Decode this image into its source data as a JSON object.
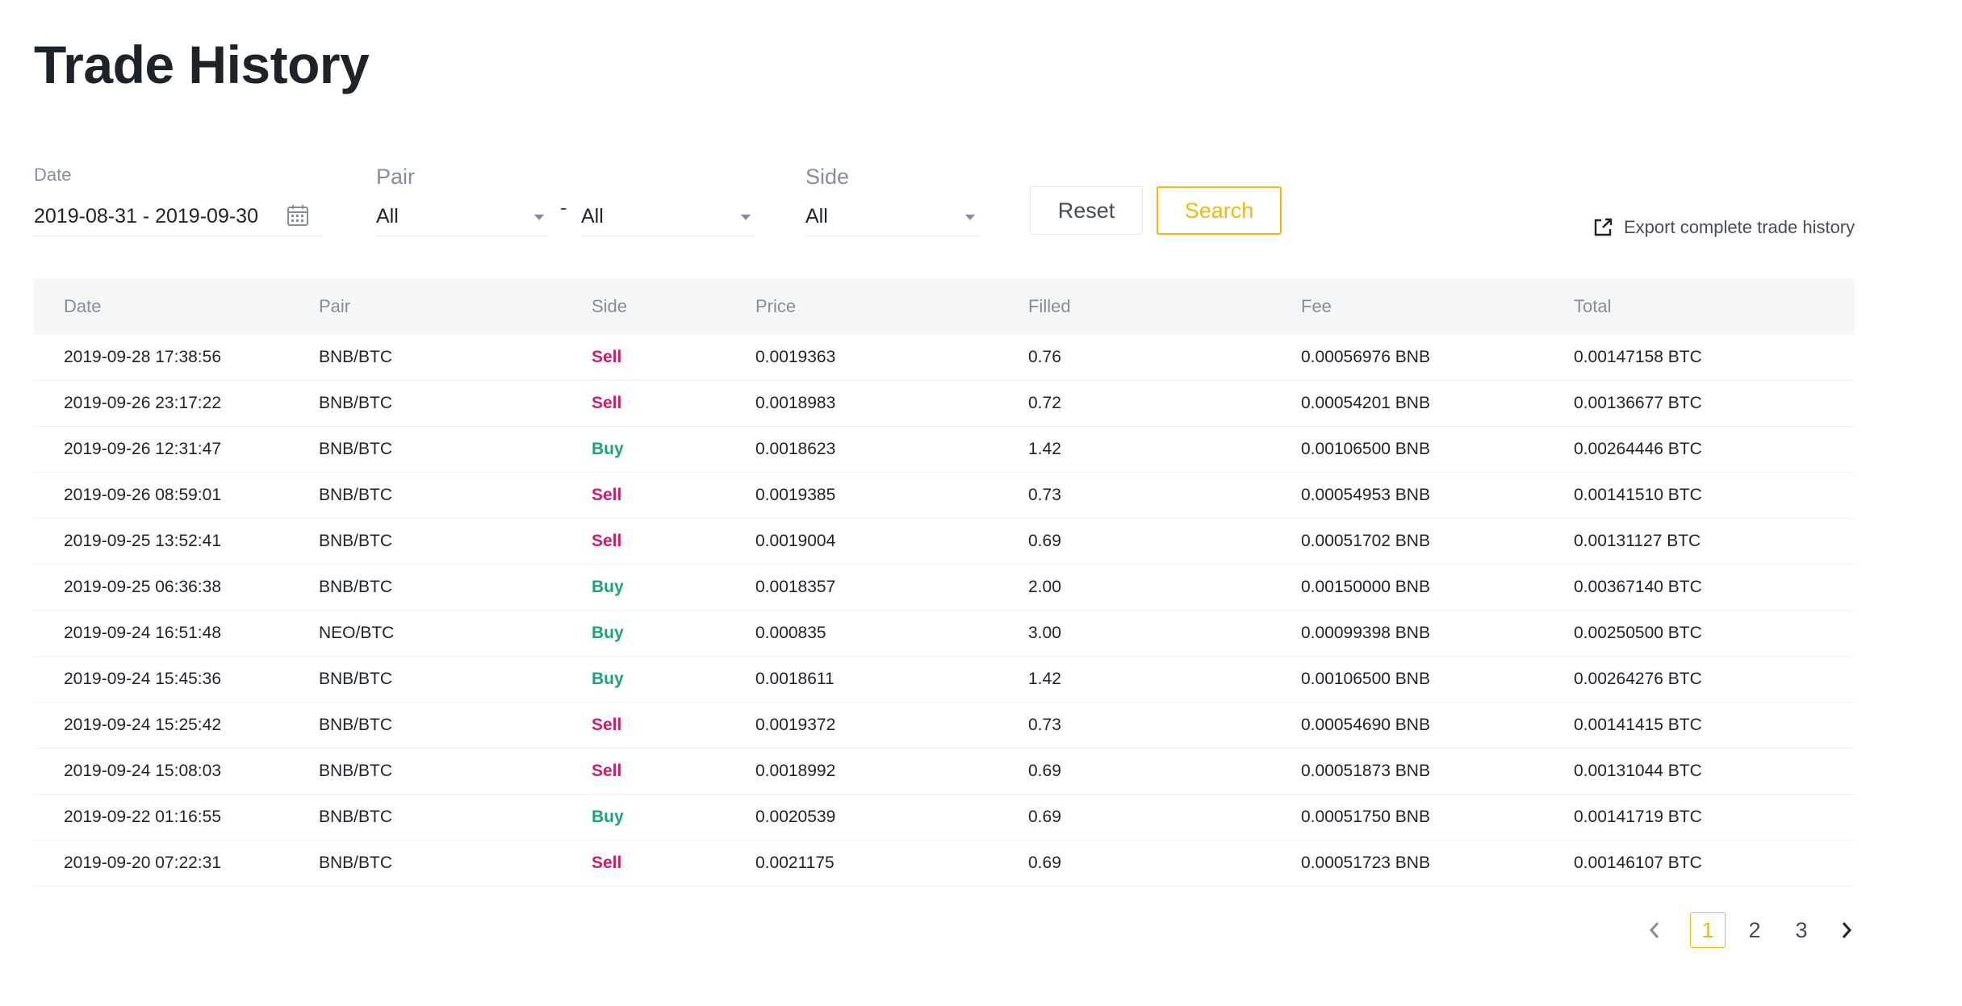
{
  "title": "Trade History",
  "filters": {
    "date_label": "Date",
    "date_value": "2019-08-31 - 2019-09-30",
    "pair_label": "Pair",
    "pair_base": "All",
    "pair_separator": "-",
    "pair_quote": "All",
    "side_label": "Side",
    "side_value": "All",
    "reset_label": "Reset",
    "search_label": "Search"
  },
  "export_label": "Export complete trade history",
  "table": {
    "headers": [
      "Date",
      "Pair",
      "Side",
      "Price",
      "Filled",
      "Fee",
      "Total"
    ],
    "rows": [
      [
        "2019-09-28 17:38:56",
        "BNB/BTC",
        "Sell",
        "0.0019363",
        "0.76",
        "0.00056976 BNB",
        "0.00147158 BTC"
      ],
      [
        "2019-09-26 23:17:22",
        "BNB/BTC",
        "Sell",
        "0.0018983",
        "0.72",
        "0.00054201 BNB",
        "0.00136677 BTC"
      ],
      [
        "2019-09-26 12:31:47",
        "BNB/BTC",
        "Buy",
        "0.0018623",
        "1.42",
        "0.00106500 BNB",
        "0.00264446 BTC"
      ],
      [
        "2019-09-26 08:59:01",
        "BNB/BTC",
        "Sell",
        "0.0019385",
        "0.73",
        "0.00054953 BNB",
        "0.00141510 BTC"
      ],
      [
        "2019-09-25 13:52:41",
        "BNB/BTC",
        "Sell",
        "0.0019004",
        "0.69",
        "0.00051702 BNB",
        "0.00131127 BTC"
      ],
      [
        "2019-09-25 06:36:38",
        "BNB/BTC",
        "Buy",
        "0.0018357",
        "2.00",
        "0.00150000 BNB",
        "0.00367140 BTC"
      ],
      [
        "2019-09-24 16:51:48",
        "NEO/BTC",
        "Buy",
        "0.000835",
        "3.00",
        "0.00099398 BNB",
        "0.00250500 BTC"
      ],
      [
        "2019-09-24 15:45:36",
        "BNB/BTC",
        "Buy",
        "0.0018611",
        "1.42",
        "0.00106500 BNB",
        "0.00264276 BTC"
      ],
      [
        "2019-09-24 15:25:42",
        "BNB/BTC",
        "Sell",
        "0.0019372",
        "0.73",
        "0.00054690 BNB",
        "0.00141415 BTC"
      ],
      [
        "2019-09-24 15:08:03",
        "BNB/BTC",
        "Sell",
        "0.0018992",
        "0.69",
        "0.00051873 BNB",
        "0.00131044 BTC"
      ],
      [
        "2019-09-22 01:16:55",
        "BNB/BTC",
        "Buy",
        "0.0020539",
        "0.69",
        "0.00051750 BNB",
        "0.00141719 BTC"
      ],
      [
        "2019-09-20 07:22:31",
        "BNB/BTC",
        "Sell",
        "0.0021175",
        "0.69",
        "0.00051723 BNB",
        "0.00146107 BTC"
      ]
    ]
  },
  "pagination": {
    "pages": [
      "1",
      "2",
      "3"
    ],
    "current": "1"
  },
  "colors": {
    "sell": "#cf1c6a",
    "buy": "#1aa37a",
    "accent": "#f0b90b"
  }
}
